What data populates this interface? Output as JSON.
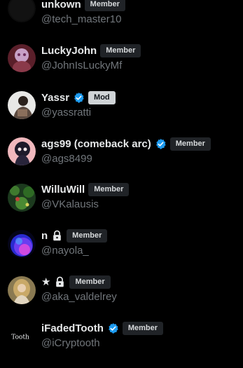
{
  "members": [
    {
      "name": "unkown",
      "handle": "@tech_master10",
      "role": "Member",
      "verified": false,
      "locked": false,
      "avatar": "dark-avatar"
    },
    {
      "name": "LuckyJohn",
      "handle": "@JohnIsLuckyMf",
      "role": "Member",
      "verified": false,
      "locked": false,
      "avatar": "pink-avatar"
    },
    {
      "name": "Yassr",
      "handle": "@yassratti",
      "role": "Mod",
      "verified": true,
      "locked": false,
      "avatar": "person-avatar"
    },
    {
      "name": "ags99 (comeback arc)",
      "handle": "@ags8499",
      "role": "Member",
      "verified": true,
      "locked": false,
      "avatar": "anime-avatar"
    },
    {
      "name": "WilluWill",
      "handle": "@VKalausis",
      "role": "Member",
      "verified": false,
      "locked": false,
      "avatar": "green-avatar"
    },
    {
      "name": "n",
      "handle": "@nayola_",
      "role": "Member",
      "verified": false,
      "locked": true,
      "avatar": "orb-avatar"
    },
    {
      "name": "★",
      "handle": "@aka_valdelrey",
      "role": "Member",
      "verified": false,
      "locked": true,
      "avatar": "portrait-avatar"
    },
    {
      "name": "iFadedTooth",
      "handle": "@iCryptooth",
      "role": "Member",
      "verified": true,
      "locked": false,
      "avatar": "tooth-text-avatar"
    }
  ],
  "tooth_avatar_text": "Tooth",
  "colors": {
    "verified": "#1d9bf0",
    "handle": "#71767b",
    "badge_bg": "#202327",
    "mod_badge_bg": "#cfd3d6"
  }
}
